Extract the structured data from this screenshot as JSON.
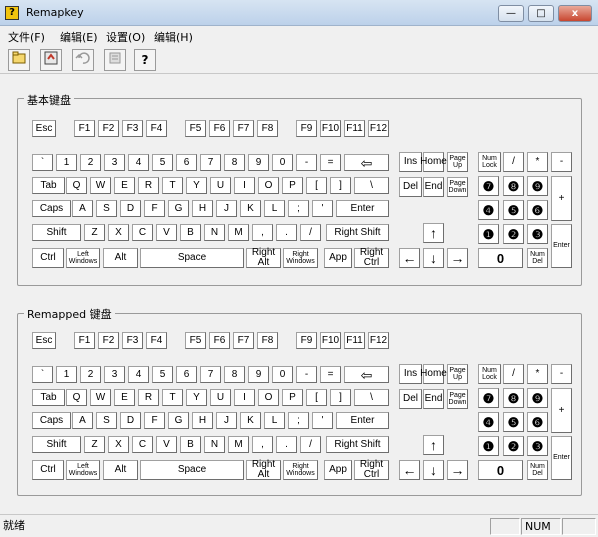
{
  "app": {
    "title": "Remapkey",
    "icon_glyph": "?"
  },
  "window_buttons": {
    "minimize": "—",
    "maximize": "□",
    "close": "x"
  },
  "menu": [
    "文件(F)",
    "编辑(E)",
    "设置(O)",
    "编辑(H)"
  ],
  "toolbar": {
    "icons": [
      "open-icon",
      "save-icon",
      "undo-icon",
      "properties-icon",
      "help-icon"
    ],
    "help_glyph": "?"
  },
  "base_group": {
    "label": "基本键盘"
  },
  "remap_group": {
    "label": "Remapped 键盘"
  },
  "keys": {
    "esc": "Esc",
    "f": [
      "F1",
      "F2",
      "F3",
      "F4",
      "F5",
      "F6",
      "F7",
      "F8",
      "F9",
      "F10",
      "F11",
      "F12"
    ],
    "row1": [
      "`",
      "1",
      "2",
      "3",
      "4",
      "5",
      "6",
      "7",
      "8",
      "9",
      "0",
      "-",
      "=",
      "⇦"
    ],
    "row2": [
      "Tab",
      "Q",
      "W",
      "E",
      "R",
      "T",
      "Y",
      "U",
      "I",
      "O",
      "P",
      "[",
      "]",
      "\\"
    ],
    "row3": [
      "Caps",
      "A",
      "S",
      "D",
      "F",
      "G",
      "H",
      "J",
      "K",
      "L",
      ";",
      "'",
      "Enter"
    ],
    "row4": [
      "Shift",
      "Z",
      "X",
      "C",
      "V",
      "B",
      "N",
      "M",
      ",",
      ".",
      "/",
      "Right Shift"
    ],
    "row5": [
      "Ctrl",
      "Left Windows",
      "Alt",
      "Space",
      "Right Alt",
      "Right Windows",
      "App",
      "Right Ctrl"
    ],
    "nav_top": [
      "Ins",
      "Home",
      "Page Up"
    ],
    "nav_bottom": [
      "Del",
      "End",
      "Page Down"
    ],
    "arrows": [
      "↑",
      "←",
      "↓",
      "→"
    ],
    "num_ops": [
      "Num Lock",
      "/",
      "*",
      "-"
    ],
    "num_digits": [
      "❼",
      "❽",
      "❾",
      "❹",
      "❺",
      "❻",
      "❶",
      "❷",
      "❸"
    ],
    "num_plus": "+",
    "num_enter": "Enter",
    "num_zero": "0",
    "num_del": "Num Del"
  },
  "status": {
    "text": "就绪",
    "num": "NUM"
  }
}
